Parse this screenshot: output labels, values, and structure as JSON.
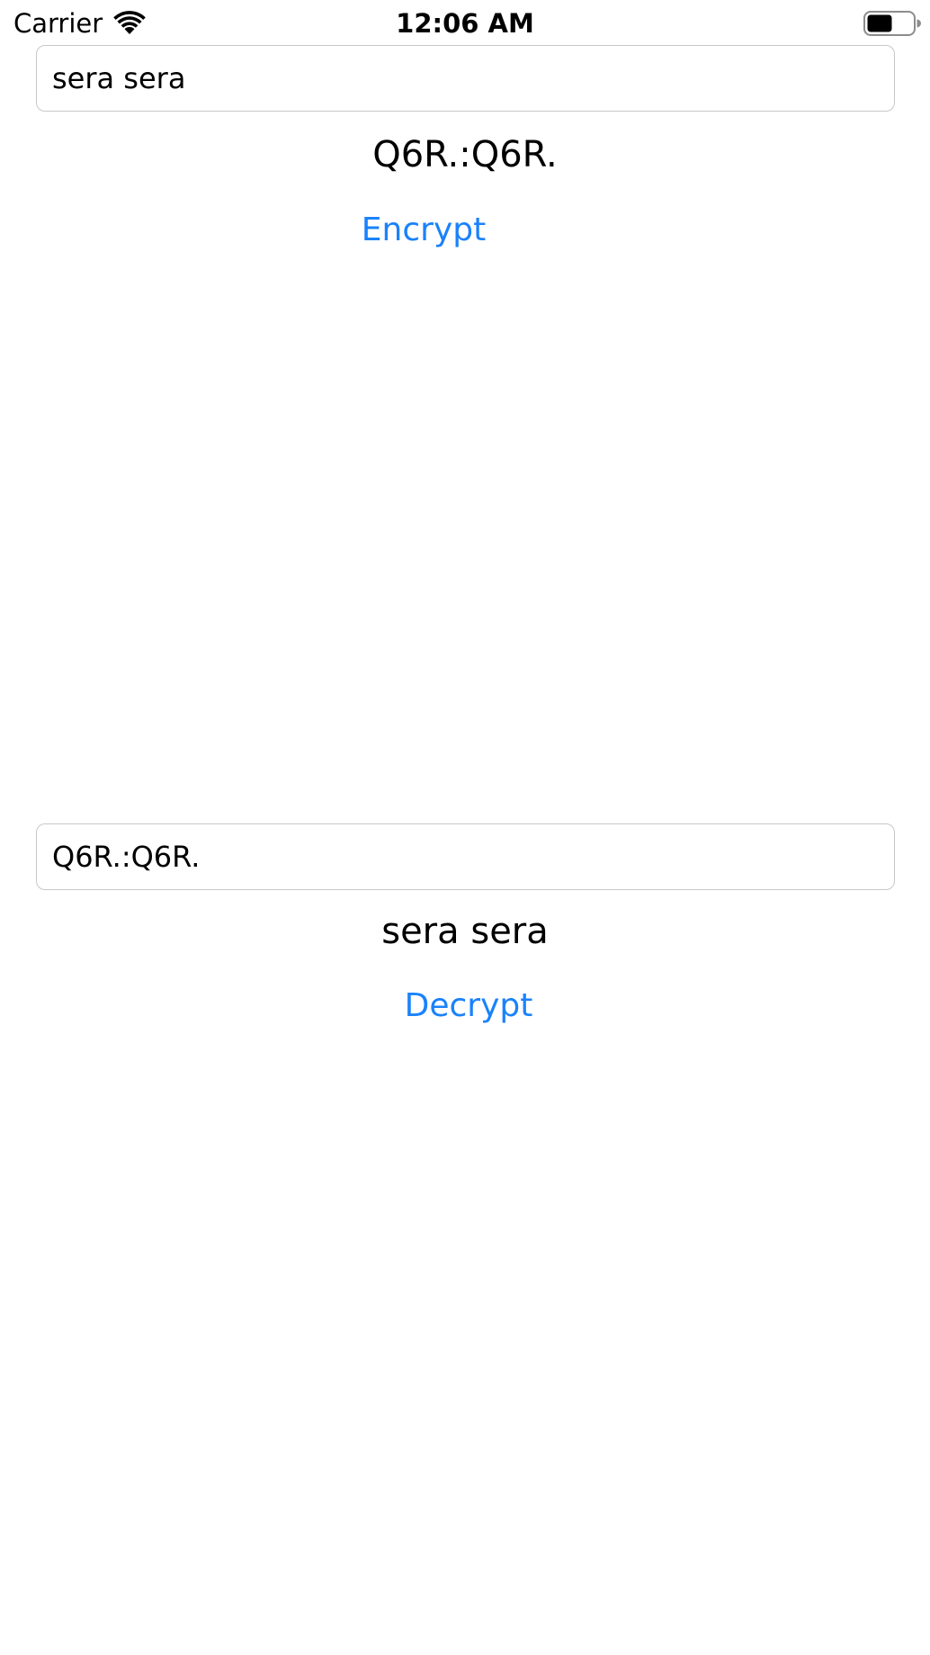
{
  "status_bar": {
    "carrier": "Carrier",
    "time": "12:06 AM",
    "wifi_icon": "wifi-icon",
    "battery_icon": "battery-icon"
  },
  "encrypt_section": {
    "input_value": "sera sera",
    "result_text": "Q6R.:Q6R.",
    "button_label": "Encrypt"
  },
  "decrypt_section": {
    "input_value": "Q6R.:Q6R.",
    "result_text": "sera sera",
    "button_label": "Decrypt"
  },
  "colors": {
    "accent": "#1a82fb",
    "field_border": "#c8c8cc",
    "text": "#000000",
    "background": "#ffffff"
  }
}
